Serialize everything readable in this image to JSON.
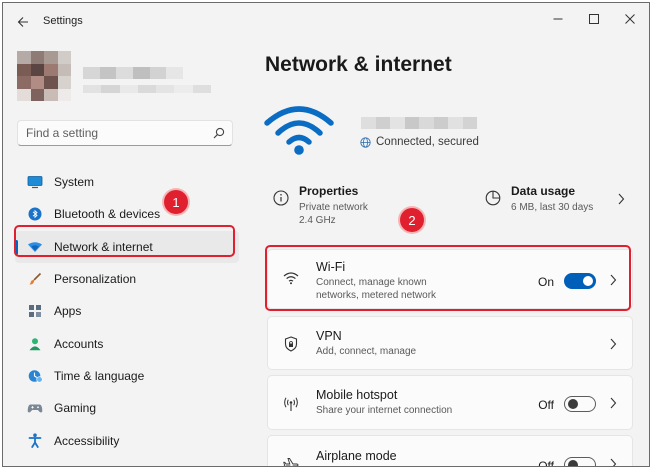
{
  "app": {
    "title": "Settings"
  },
  "search": {
    "placeholder": "Find a setting"
  },
  "sidebar": {
    "items": [
      {
        "label": "System"
      },
      {
        "label": "Bluetooth & devices"
      },
      {
        "label": "Network & internet"
      },
      {
        "label": "Personalization"
      },
      {
        "label": "Apps"
      },
      {
        "label": "Accounts"
      },
      {
        "label": "Time & language"
      },
      {
        "label": "Gaming"
      },
      {
        "label": "Accessibility"
      }
    ],
    "active_item": "Network & internet"
  },
  "annotations": {
    "step1": "1",
    "step2": "2"
  },
  "main": {
    "title": "Network & internet",
    "connection_status": "Connected, secured",
    "properties": {
      "title": "Properties",
      "line1": "Private network",
      "line2": "2.4 GHz"
    },
    "data_usage": {
      "title": "Data usage",
      "subtitle": "6 MB, last 30 days"
    },
    "wifi": {
      "title": "Wi-Fi",
      "subtitle": "Connect, manage known networks, metered network",
      "state": "On"
    },
    "vpn": {
      "title": "VPN",
      "subtitle": "Add, connect, manage"
    },
    "hotspot": {
      "title": "Mobile hotspot",
      "subtitle": "Share your internet connection",
      "state": "Off"
    },
    "airplane": {
      "title": "Airplane mode",
      "state": "Off"
    }
  },
  "colors": {
    "accent": "#0067c0",
    "highlight": "#e0202f",
    "window_bg": "#f3f3f3",
    "card_bg": "#fbfbfb"
  }
}
